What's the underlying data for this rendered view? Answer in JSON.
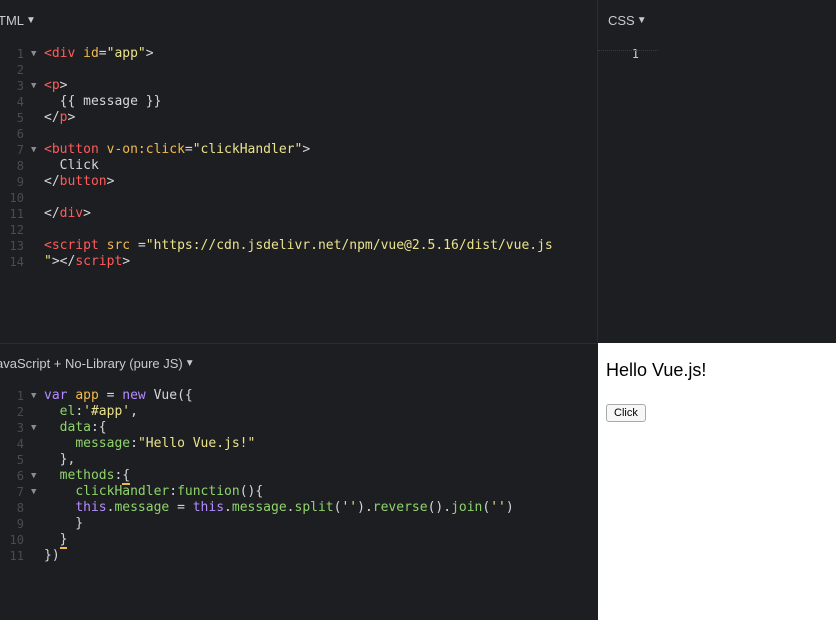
{
  "html_panel": {
    "title": "TML",
    "lines": [
      {
        "n": "1",
        "fold": true,
        "parts": [
          [
            "tag",
            "<div "
          ],
          [
            "attr",
            "id"
          ],
          [
            "plain",
            "="
          ],
          [
            "str",
            "\"app\""
          ],
          [
            "plain",
            ">"
          ]
        ]
      },
      {
        "n": "2",
        "fold": false,
        "parts": []
      },
      {
        "n": "3",
        "fold": true,
        "parts": [
          [
            "tag",
            "<p"
          ],
          [
            "plain",
            ">"
          ]
        ]
      },
      {
        "n": "4",
        "fold": false,
        "parts": [
          [
            "plain",
            "  {{ message }}"
          ]
        ]
      },
      {
        "n": "5",
        "fold": false,
        "parts": [
          [
            "plain",
            "</"
          ],
          [
            "tag",
            "p"
          ],
          [
            "plain",
            ">"
          ]
        ]
      },
      {
        "n": "6",
        "fold": false,
        "parts": []
      },
      {
        "n": "7",
        "fold": true,
        "parts": [
          [
            "tag",
            "<button "
          ],
          [
            "attr",
            "v-on:click"
          ],
          [
            "plain",
            "="
          ],
          [
            "str",
            "\"clickHandler\""
          ],
          [
            "plain",
            ">"
          ]
        ]
      },
      {
        "n": "8",
        "fold": false,
        "parts": [
          [
            "plain",
            "  Click"
          ]
        ]
      },
      {
        "n": "9",
        "fold": false,
        "parts": [
          [
            "plain",
            "</"
          ],
          [
            "tag",
            "button"
          ],
          [
            "plain",
            ">"
          ]
        ]
      },
      {
        "n": "10",
        "fold": false,
        "parts": []
      },
      {
        "n": "11",
        "fold": false,
        "parts": [
          [
            "plain",
            "</"
          ],
          [
            "tag",
            "div"
          ],
          [
            "plain",
            ">"
          ]
        ]
      },
      {
        "n": "12",
        "fold": false,
        "parts": []
      },
      {
        "n": "13",
        "fold": false,
        "parts": [
          [
            "tag",
            "<script "
          ],
          [
            "attr",
            "src "
          ],
          [
            "plain",
            "="
          ],
          [
            "str",
            "\"https://cdn.jsdelivr.net/npm/vue@2.5.16/dist/vue.js"
          ]
        ]
      },
      {
        "n": "14",
        "fold": false,
        "parts": [
          [
            "str",
            "\""
          ],
          [
            "plain",
            "></"
          ],
          [
            "tag",
            "script"
          ],
          [
            "plain",
            ">"
          ]
        ]
      }
    ]
  },
  "css_panel": {
    "title": "CSS",
    "lines": [
      {
        "n": "1"
      }
    ]
  },
  "js_panel": {
    "title": "avaScript + No-Library (pure JS)",
    "lines": [
      {
        "n": "1",
        "fold": true,
        "parts": [
          [
            "kw",
            "var "
          ],
          [
            "var",
            "app "
          ],
          [
            "op",
            "= "
          ],
          [
            "kw",
            "new "
          ],
          [
            "plain",
            "Vue({"
          ]
        ]
      },
      {
        "n": "2",
        "fold": false,
        "parts": [
          [
            "plain",
            "  "
          ],
          [
            "fn",
            "el"
          ],
          [
            "plain",
            ":"
          ],
          [
            "str",
            "'#app'"
          ],
          [
            "plain",
            ","
          ]
        ]
      },
      {
        "n": "3",
        "fold": true,
        "parts": [
          [
            "plain",
            "  "
          ],
          [
            "fn",
            "data"
          ],
          [
            "plain",
            ":{"
          ]
        ]
      },
      {
        "n": "4",
        "fold": false,
        "parts": [
          [
            "plain",
            "    "
          ],
          [
            "fn",
            "message"
          ],
          [
            "plain",
            ":"
          ],
          [
            "str",
            "\"Hello Vue.js!\""
          ]
        ]
      },
      {
        "n": "5",
        "fold": false,
        "parts": [
          [
            "plain",
            "  },"
          ]
        ]
      },
      {
        "n": "6",
        "fold": true,
        "parts": [
          [
            "plain",
            "  "
          ],
          [
            "fn",
            "methods"
          ],
          [
            "plain",
            ":"
          ],
          [
            "underline",
            "{"
          ]
        ]
      },
      {
        "n": "7",
        "fold": true,
        "parts": [
          [
            "plain",
            "    "
          ],
          [
            "fn",
            "clickHandler"
          ],
          [
            "plain",
            ":"
          ],
          [
            "fn",
            "function"
          ],
          [
            "plain",
            "(){"
          ]
        ]
      },
      {
        "n": "8",
        "fold": false,
        "parts": [
          [
            "plain",
            "    "
          ],
          [
            "kw",
            "this"
          ],
          [
            "plain",
            "."
          ],
          [
            "fn",
            "message "
          ],
          [
            "op",
            "= "
          ],
          [
            "kw",
            "this"
          ],
          [
            "plain",
            "."
          ],
          [
            "fn",
            "message"
          ],
          [
            "plain",
            "."
          ],
          [
            "fn",
            "split"
          ],
          [
            "plain",
            "("
          ],
          [
            "str",
            "''"
          ],
          [
            "plain",
            ")."
          ],
          [
            "fn",
            "reverse"
          ],
          [
            "plain",
            "()."
          ],
          [
            "fn",
            "join"
          ],
          [
            "plain",
            "("
          ],
          [
            "str",
            "''"
          ],
          [
            "plain",
            ")"
          ]
        ]
      },
      {
        "n": "9",
        "fold": false,
        "parts": [
          [
            "plain",
            "    }"
          ]
        ]
      },
      {
        "n": "10",
        "fold": false,
        "parts": [
          [
            "plain",
            "  "
          ],
          [
            "underline",
            "}"
          ]
        ]
      },
      {
        "n": "11",
        "fold": false,
        "parts": [
          [
            "plain",
            "})"
          ]
        ]
      }
    ]
  },
  "result": {
    "heading": "Hello Vue.js!",
    "button_label": "Click"
  },
  "icons": {
    "caret": "caret-down-icon",
    "fold": "fold-arrow-icon"
  },
  "colors": {
    "background": "#1d1e22",
    "tag": "#ff5b5b",
    "attribute": "#f2b94e",
    "string": "#ebe28c",
    "keyword": "#b58cff",
    "function": "#8fd36a"
  }
}
